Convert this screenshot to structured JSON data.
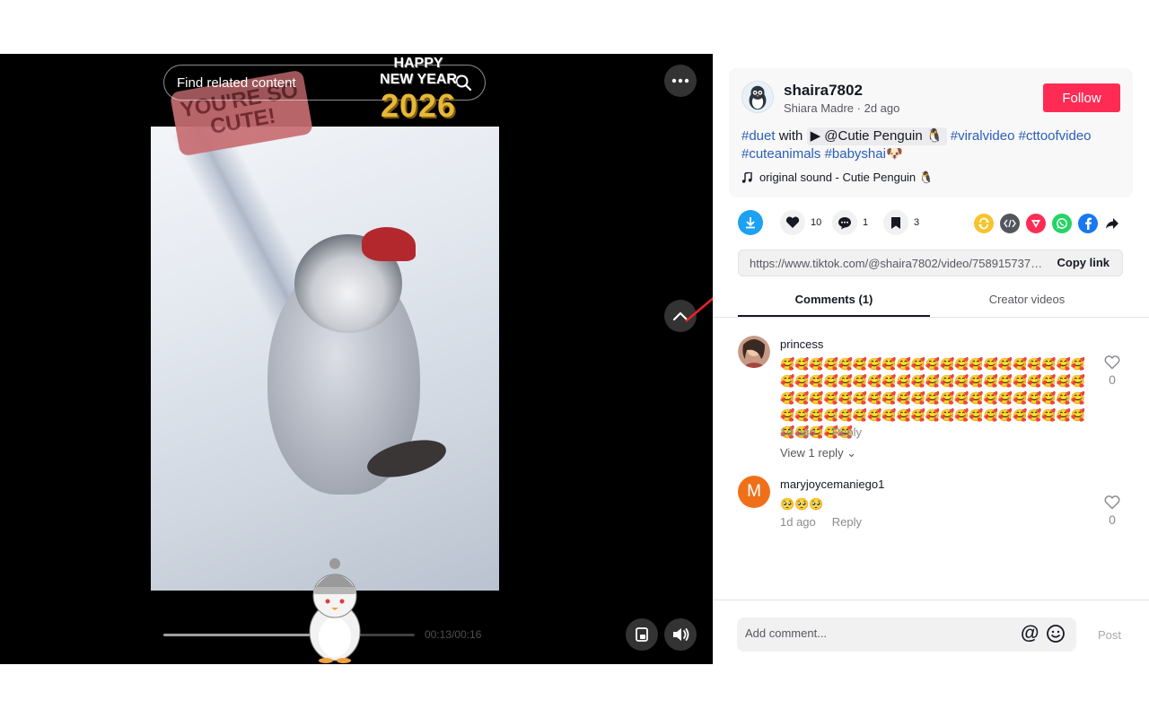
{
  "video": {
    "search_placeholder": "Find related content",
    "sticker_cute": "YOU'RE SO CUTE!",
    "sticker_ny_line1": "HAPPY",
    "sticker_ny_line2": "NEW YEAR",
    "sticker_ny_year": "2026",
    "time": "00:13/00:16",
    "progress_fraction": 0.59
  },
  "post": {
    "username": "shaira7802",
    "subline": "Shiara Madre · 2d ago",
    "follow_label": "Follow",
    "desc_tag1": "#duet",
    "desc_with": " with ",
    "desc_mention": "▶ @Cutie Penguin 🐧",
    "desc_tag2": "#viralvideo",
    "desc_tag3": "#cttoofvideo",
    "desc_tag4": "#cuteanimals",
    "desc_tag5": "#babyshai🐶",
    "sound": "original sound - Cutie Penguin 🐧"
  },
  "actions": {
    "likes": "10",
    "comments": "1",
    "saves": "3"
  },
  "link": {
    "url": "https://www.tiktok.com/@shaira7802/video/7589157371234567890",
    "copy_label": "Copy link"
  },
  "tabs": {
    "comments": "Comments (1)",
    "creator": "Creator videos"
  },
  "comments": [
    {
      "user": "princess",
      "text": "🥰🥰🥰🥰🥰🥰🥰🥰🥰🥰🥰🥰🥰🥰🥰🥰🥰🥰🥰🥰🥰🥰🥰🥰🥰🥰🥰🥰🥰🥰🥰🥰🥰🥰🥰🥰🥰🥰🥰🥰🥰🥰🥰🥰🥰🥰🥰🥰🥰🥰🥰🥰🥰🥰🥰🥰🥰🥰🥰🥰🥰🥰🥰🥰🥰🥰🥰🥰🥰🥰🥰🥰🥰🥰🥰🥰🥰🥰🥰🥰🥰🥰🥰🥰🥰🥰🥰🥰🥰",
      "time": "1d ago",
      "reply": "Reply",
      "likes": "0",
      "view_reply": "View 1 reply ⌄"
    },
    {
      "user": "maryjoycemaniego1",
      "avatar_letter": "M",
      "text": "🥺🥺🥺",
      "time": "1d ago",
      "reply": "Reply",
      "likes": "0"
    }
  ],
  "composer": {
    "placeholder": "Add comment...",
    "at": "@",
    "post_label": "Post"
  },
  "colors": {
    "follow": "#fe2c55",
    "tag": "#2b5db9",
    "download": "#1da1f2"
  },
  "icons": [
    "search-icon",
    "more-icon",
    "chevron-up-icon",
    "miniplayer-icon",
    "volume-icon",
    "download-icon",
    "heart-icon",
    "comment-icon",
    "bookmark-icon",
    "repost-icon",
    "embed-icon",
    "send-icon",
    "whatsapp-icon",
    "facebook-icon",
    "share-arrow-icon",
    "music-note-icon",
    "emoji-icon"
  ]
}
